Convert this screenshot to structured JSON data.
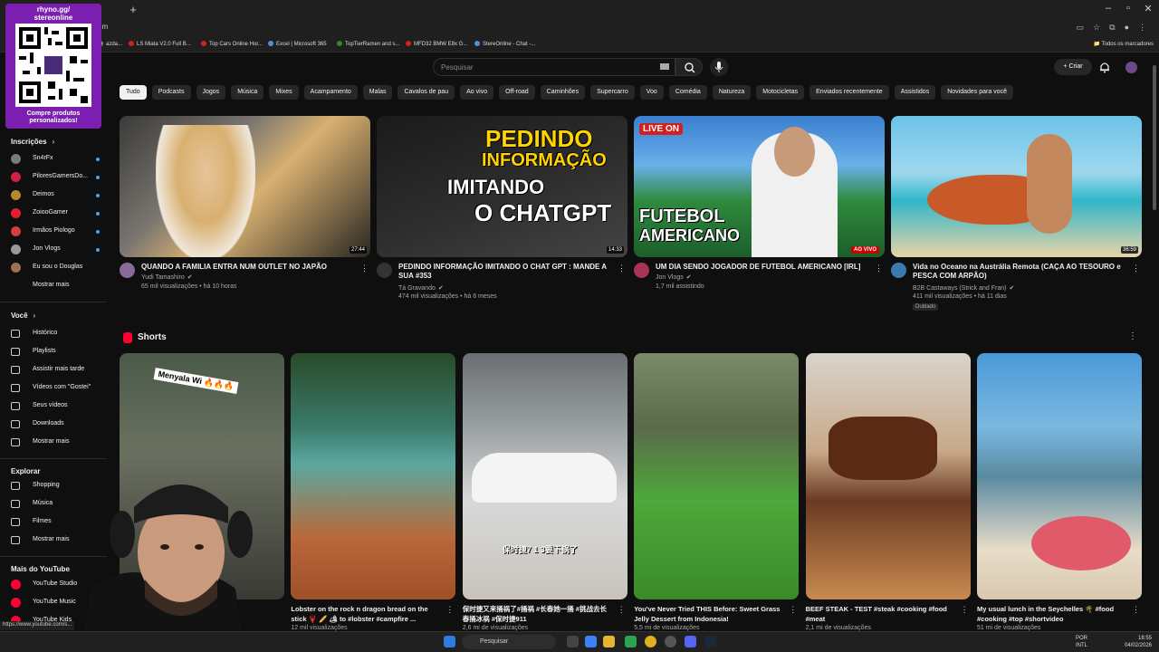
{
  "browser": {
    "url": "om",
    "status_url": "https://www.youtube.com/s...",
    "bookmarks": [
      {
        "label": "azda...",
        "color": "#888888"
      },
      {
        "label": "LS Miata V2.0 Full B...",
        "color": "#d02020"
      },
      {
        "label": "Top Cars Online Hor...",
        "color": "#d02020"
      },
      {
        "label": "Excel | Microsoft 365",
        "color": "#4a90e2"
      },
      {
        "label": "TopTierRamen and s...",
        "color": "#2a8a2a"
      },
      {
        "label": "MFD32 BMW E8x G...",
        "color": "#d02020"
      },
      {
        "label": "StereOnline - Chat -...",
        "color": "#4a90e2"
      }
    ],
    "bookmarks_all": "Todos os marcadores"
  },
  "overlay": {
    "qr_top": "rhyno.gg/\nstereonline",
    "qr_bottom": "Compre produtos\npersonalizados!"
  },
  "header": {
    "search_placeholder": "Pesquisar",
    "create_label": "Criar"
  },
  "chips": [
    "Tudo",
    "Podcasts",
    "Jogos",
    "Música",
    "Mixes",
    "Acampamento",
    "Malas",
    "Cavalos de pau",
    "Ao vivo",
    "Off-road",
    "Caminhões",
    "Supercarro",
    "Voo",
    "Comédia",
    "Natureza",
    "Motocicletas",
    "Enviados recentemente",
    "Assistidos",
    "Novidades para você"
  ],
  "sidebar": {
    "subs_title": "Inscrições",
    "subs": [
      {
        "label": "Sn4rFx",
        "color": "#7a7a7a"
      },
      {
        "label": "PiloresGamersDo...",
        "color": "#cc2244"
      },
      {
        "label": "Deimos",
        "color": "#b8862b"
      },
      {
        "label": "ZoiooGamer",
        "color": "#e02030"
      },
      {
        "label": "Irmãos Piologo",
        "color": "#d04040"
      },
      {
        "label": "Jon Vlogs",
        "color": "#999999"
      },
      {
        "label": "Eu sou o Douglas",
        "color": "#a07050"
      }
    ],
    "subs_more": "Mostrar mais",
    "you_title": "Você",
    "you_items": [
      "Histórico",
      "Playlists",
      "Assistir mais tarde",
      "Vídeos com \"Gostei\"",
      "Seus vídeos",
      "Downloads",
      "Mostrar mais"
    ],
    "explore_title": "Explorar",
    "explore_items": [
      "Shopping",
      "Música",
      "Filmes",
      "Mostrar mais"
    ],
    "more_title": "Mais do YouTube",
    "more_items": [
      "YouTube Studio",
      "YouTube Music",
      "YouTube Kids"
    ]
  },
  "videos": [
    {
      "title": "QUANDO A FAMILIA ENTRA NUM OUTLET NO JAPÃO",
      "channel": "Yudi Tamashiro",
      "meta": "65 mil visualizações • há 10 horas",
      "duration": "27:44",
      "avatar_color": "#8a6a9a"
    },
    {
      "title": "PEDINDO INFORMAÇÃO IMITANDO O CHAT GPT : MANDE A SUA #353",
      "channel": "Tá Gravando",
      "meta": "474 mil visualizações • há 6 meses",
      "duration": "14:33",
      "avatar_color": "#333333",
      "thumb_text": [
        "PEDINDO",
        "INFORMAÇÃO",
        "IMITANDO",
        "O CHATGPT"
      ]
    },
    {
      "title": "UM DIA SENDO JOGADOR DE FUTEBOL AMERICANO [IRL]",
      "channel": "Jon Vlogs",
      "meta": "1,7 mil assistindo",
      "live_badge": "AO VIVO",
      "avatar_color": "#aa3355",
      "thumb_text": [
        "LIVE ON",
        "FUTEBOL",
        "AMERICANO"
      ]
    },
    {
      "title": "Vida no Oceano na Austrália Remota (CAÇA AO TESOURO e PESCA COM ARPÃO)",
      "channel": "B2B Castaways (Strick and Fran)",
      "meta": "411 mil visualizações • há 11 dias",
      "duration": "36:59",
      "badge": "Dublado",
      "avatar_color": "#3a7ab0"
    }
  ],
  "shorts": {
    "title": "Shorts",
    "items": [
      {
        "title": "",
        "meta": "",
        "thumb_text": "Menyala Wi 🔥🔥🔥"
      },
      {
        "title": "Lobster on the rock n dragon bread on the stick 🦞 🥖 🏕 to #lobster #campfire ...",
        "meta": "12 mil visualizações"
      },
      {
        "title": "保时捷又来捅祸了#捅祸 #长春她一捅 #挑战去长春捅冰祸 #保时捷911",
        "meta": "2,6 mi de visualizações",
        "thumb_text": "保时捷7 1 3要下锅了"
      },
      {
        "title": "You've Never Tried THIS Before: Sweet Grass Jelly Dessert from Indonesia!",
        "meta": "5,5 mi de visualizações"
      },
      {
        "title": "BEEF STEAK - TEST #steak #cooking #food #meat",
        "meta": "2,1 mi de visualizações"
      },
      {
        "title": "My usual lunch in the Seychelles 🌴 #food #cooking #top #shortvideo",
        "meta": "51 mi de visualizações"
      }
    ]
  },
  "taskbar": {
    "search": "Pesquisar",
    "lang": "POR\nINTL",
    "time": "18:55",
    "date": "04/02/2026"
  }
}
